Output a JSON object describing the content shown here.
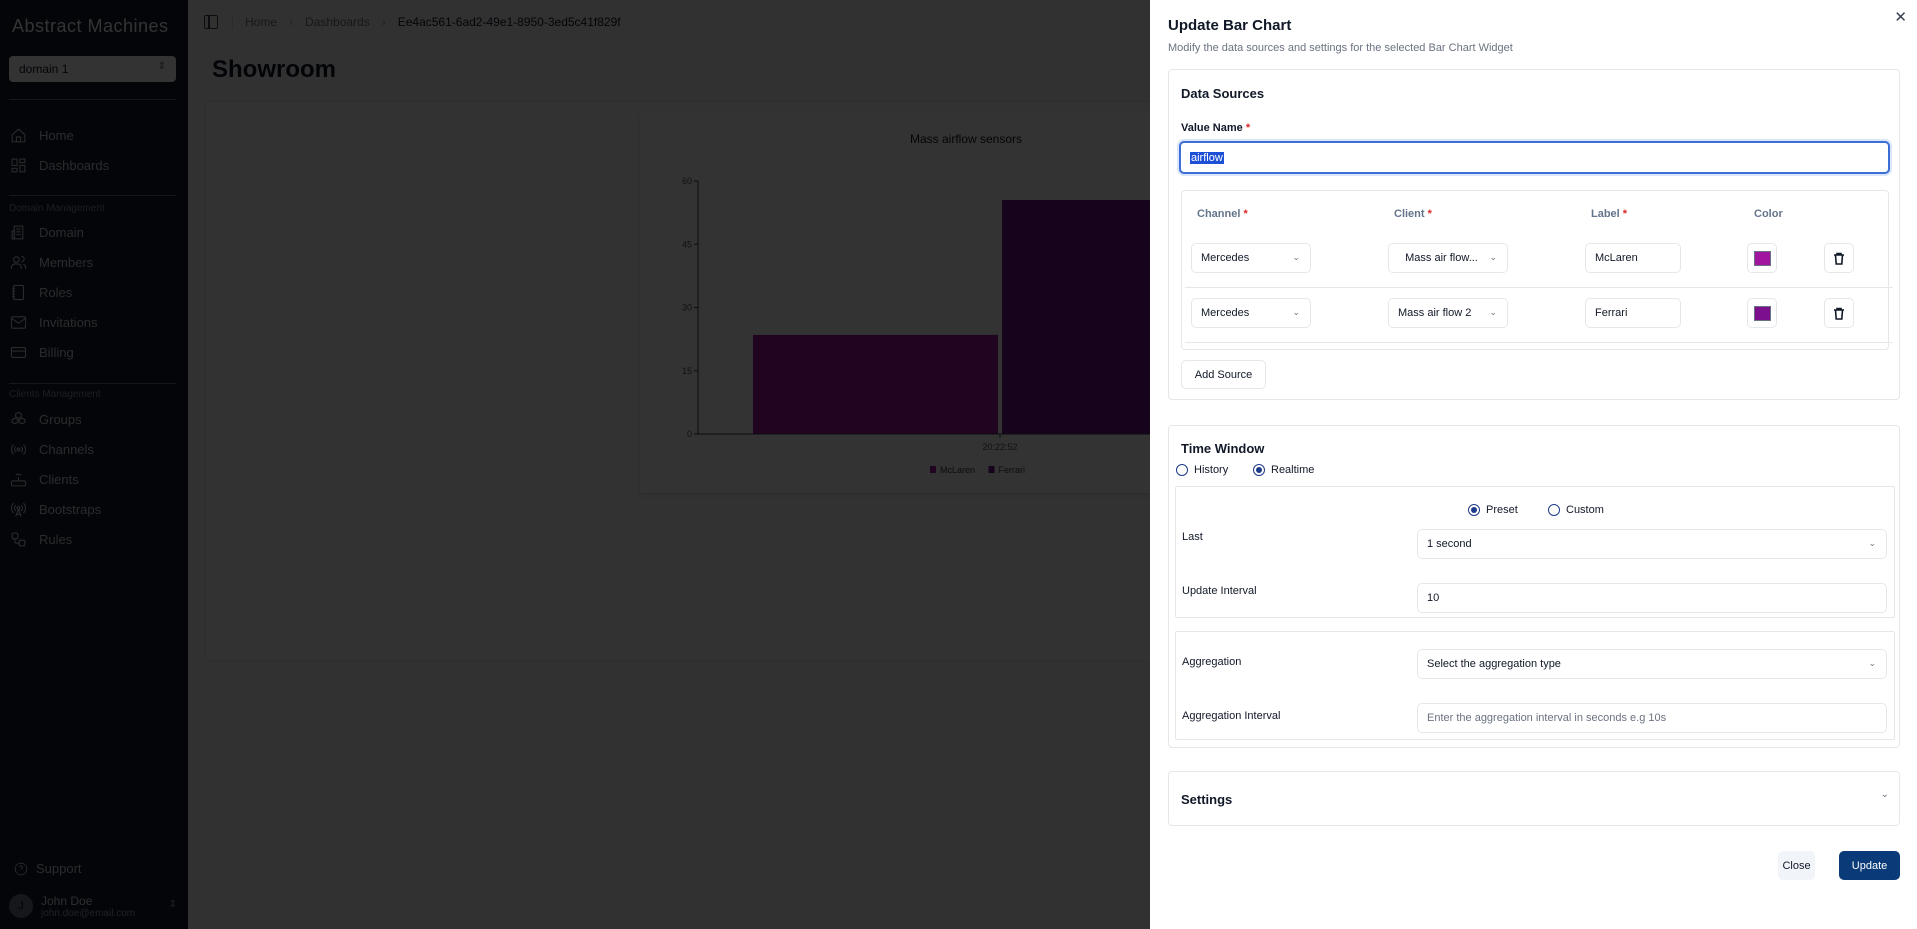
{
  "sidebar": {
    "brand": "Abstract Machines",
    "domain_select": "domain 1",
    "items_top": [
      {
        "label": "Home",
        "icon": "home-icon"
      },
      {
        "label": "Dashboards",
        "icon": "dashboard-icon"
      }
    ],
    "domain_section_title": "Domain Management",
    "domain_items": [
      {
        "label": "Domain",
        "icon": "building-icon"
      },
      {
        "label": "Members",
        "icon": "users-icon"
      },
      {
        "label": "Roles",
        "icon": "notebook-icon"
      },
      {
        "label": "Invitations",
        "icon": "mail-icon"
      },
      {
        "label": "Billing",
        "icon": "credit-card-icon"
      }
    ],
    "clients_section_title": "Clients Management",
    "clients_items": [
      {
        "label": "Groups",
        "icon": "boxes-icon"
      },
      {
        "label": "Channels",
        "icon": "radio-icon"
      },
      {
        "label": "Clients",
        "icon": "router-icon"
      },
      {
        "label": "Bootstraps",
        "icon": "antenna-icon"
      },
      {
        "label": "Rules",
        "icon": "workflow-icon"
      }
    ],
    "support": "Support",
    "user": {
      "initial": "J",
      "name": "John Doe",
      "email": "john.doe@email.com"
    }
  },
  "topbar": {
    "breadcrumb": [
      "Home",
      "Dashboards"
    ],
    "current": "Ee4ac561-6ad2-49e1-8950-3ed5c41f829f"
  },
  "page": {
    "title": "Showroom"
  },
  "chart_data": {
    "type": "bar",
    "title": "Mass airflow sensors",
    "categories": [
      "20:22:52"
    ],
    "series": [
      {
        "name": "McLaren",
        "values": [
          23.5
        ],
        "color": "#a0169f"
      },
      {
        "name": "Ferrari",
        "values": [
          55.5
        ],
        "color": "#7b0f8e"
      }
    ],
    "xlabel": "",
    "ylabel": "",
    "ylim": [
      0,
      60
    ],
    "yticks": [
      0,
      15,
      30,
      45,
      60
    ],
    "legend": "bottom"
  },
  "dialog": {
    "title": "Update Bar Chart",
    "subtitle": "Modify the data sources and settings for the selected Bar Chart Widget",
    "data_sources": {
      "title": "Data Sources",
      "value_name_label": "Value Name",
      "value_name": "airflow",
      "headers": {
        "channel": "Channel",
        "client": "Client",
        "label": "Label",
        "color": "Color"
      },
      "rows": [
        {
          "channel": "Mercedes",
          "client": "Mass air flow...",
          "label": "McLaren",
          "color": "#a0169f"
        },
        {
          "channel": "Mercedes",
          "client": "Mass air flow 2",
          "label": "Ferrari",
          "color": "#7b0f8e"
        }
      ],
      "add_source": "Add Source"
    },
    "time_window": {
      "title": "Time Window",
      "mode_options": [
        "History",
        "Realtime"
      ],
      "mode_selected": "Realtime",
      "range_options": [
        "Preset",
        "Custom"
      ],
      "range_selected": "Preset",
      "last_label": "Last",
      "last_value": "1 second",
      "update_interval_label": "Update Interval",
      "update_interval_value": "10",
      "aggregation_label": "Aggregation",
      "aggregation_placeholder": "Select the aggregation type",
      "aggregation_interval_label": "Aggregation Interval",
      "aggregation_interval_placeholder": "Enter the aggregation interval in seconds e.g 10s"
    },
    "settings": {
      "title": "Settings"
    },
    "buttons": {
      "close": "Close",
      "update": "Update"
    }
  }
}
